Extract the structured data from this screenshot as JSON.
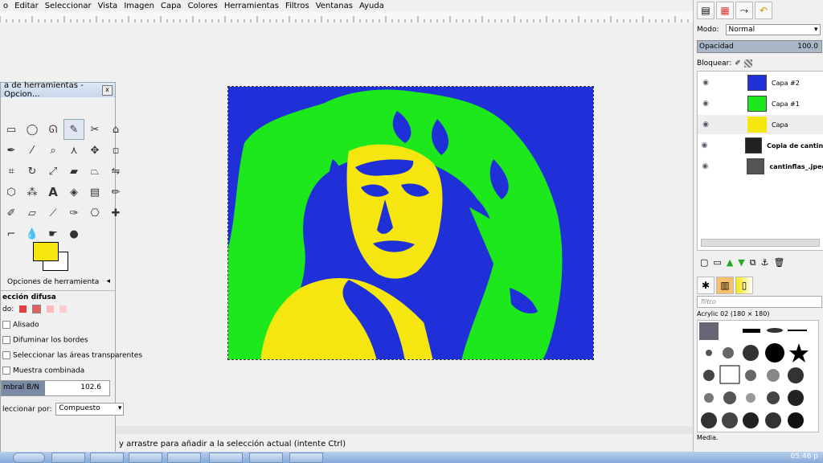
{
  "menu": [
    "o",
    "Editar",
    "Seleccionar",
    "Vista",
    "Imagen",
    "Capa",
    "Colores",
    "Herramientas",
    "Filtros",
    "Ventanas",
    "Ayuda"
  ],
  "toolbox": {
    "title": "a de herramientas - Opcion...",
    "close": "x",
    "tab_label": "Opciones de herramienta",
    "section_title": "ección difusa",
    "mode_label": "do:",
    "alias": "Alisado",
    "feather": "Difuminar los bordes",
    "transparent": "Seleccionar las áreas transparentes",
    "sample_merged": "Muestra combinada",
    "threshold_label": "mbral B/N",
    "threshold_value": "102.6",
    "threshold_fraction": 0.4,
    "select_by_label": "leccionar por:",
    "select_by_value": "Compuesto"
  },
  "status": {
    "text": "y arrastre para añadir a la selección actual (intente Ctrl)"
  },
  "layers_panel": {
    "mode_label": "Modo:",
    "mode_value": "Normal",
    "opacity_label": "Opacidad",
    "opacity_value": "100.0",
    "lock_label": "Bloquear:",
    "layers": [
      {
        "name": "Capa #2"
      },
      {
        "name": "Capa #1"
      },
      {
        "name": "Capa"
      },
      {
        "name": "Copia de cantinfla"
      },
      {
        "name": "cantinflas_.jpeg"
      }
    ]
  },
  "brushes": {
    "filter_placeholder": "filtro",
    "current_brush": "Acrylic 02 (180 × 180)",
    "media_label": "Media."
  },
  "taskbar": {
    "clock": "05:46 p"
  },
  "colors": {
    "blue": "#2030d8",
    "green": "#1ce81c",
    "yellow": "#f5e60f",
    "fg": "#f5e60f"
  }
}
